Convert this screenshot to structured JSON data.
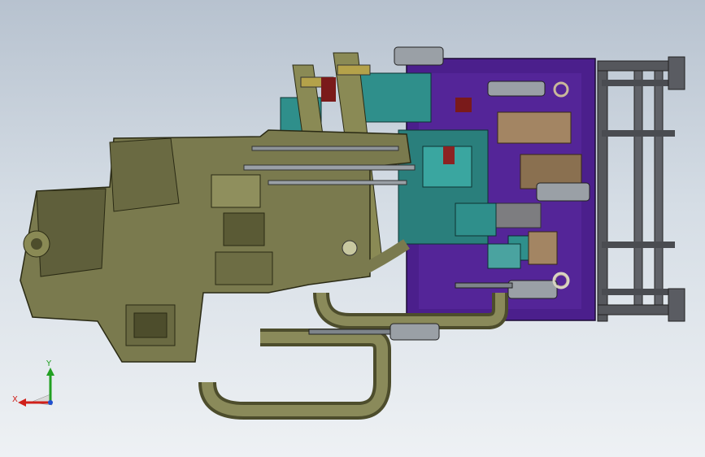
{
  "viewport": {
    "background_top": "#b7c2cf",
    "background_bottom": "#eef1f4"
  },
  "colors": {
    "olive_body": "#7a7a4e",
    "olive_dark": "#4d4d2c",
    "purple_plate": "#4b1f8c",
    "teal_parts": "#2f8f8b",
    "gray_frame": "#55575c",
    "tan_blocks": "#a38563",
    "silver_cylinders": "#9aa0a6",
    "axis_x": "#d0201a",
    "axis_y": "#22a022",
    "axis_z": "#1f4fd0"
  },
  "triad": {
    "y_label": "Y",
    "x_label": "X"
  }
}
